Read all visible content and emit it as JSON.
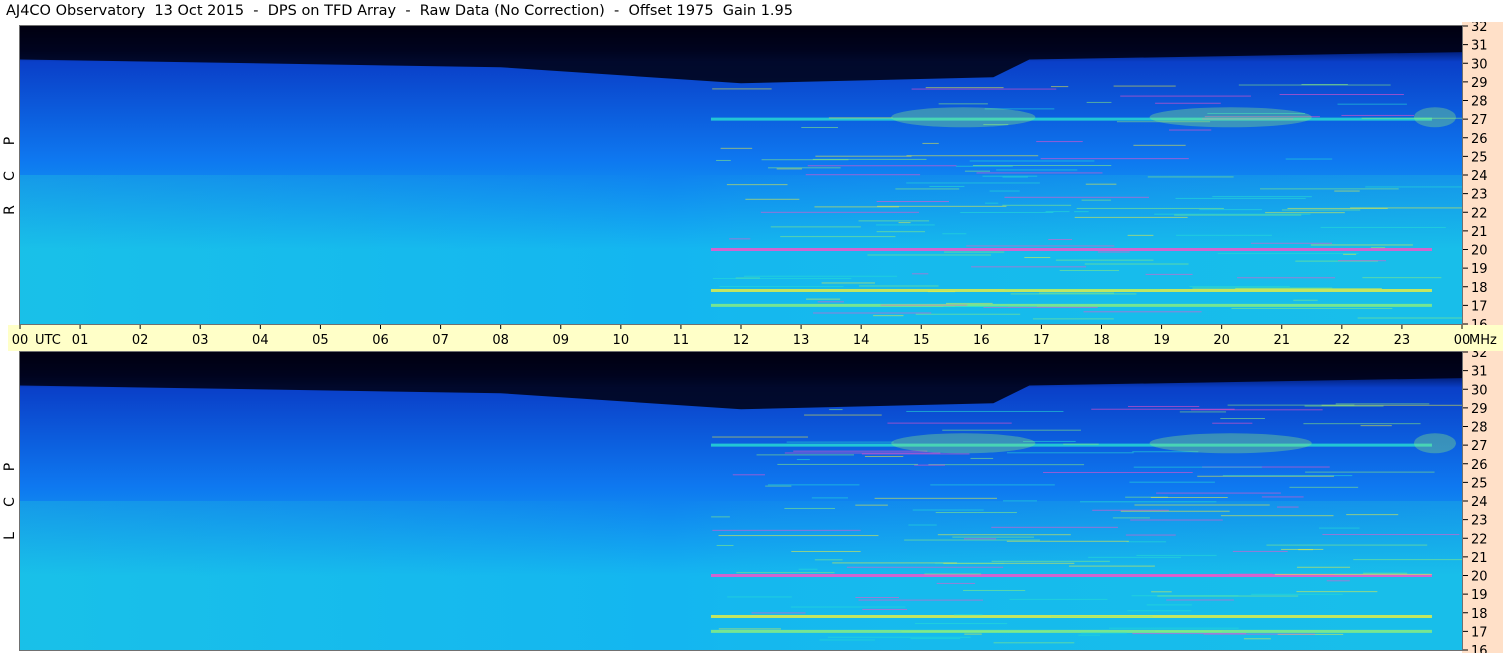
{
  "title": "AJ4CO Observatory  13 Oct 2015  -  DPS on TFD Array  -  Raw Data (No Correction)  -  Offset 1975  Gain 1.95",
  "colors": {
    "background": "#ffffff",
    "freq_axis_bg": "#ffe0c8",
    "time_axis_bg": "#ffffc8",
    "colormap": [
      "#000010",
      "#001a6e",
      "#0a3fc8",
      "#0e78f0",
      "#14b6f0",
      "#28e0d2",
      "#8ef07a",
      "#f0f03c",
      "#ff50c8"
    ]
  },
  "panels": [
    {
      "name": "R C P",
      "letters": [
        "P",
        "C",
        "R"
      ]
    },
    {
      "name": "L C P",
      "letters": [
        "P",
        "C",
        "L"
      ]
    }
  ],
  "chart_data": {
    "type": "heatmap",
    "title": "AJ4CO Observatory  13 Oct 2015  -  DPS on TFD Array  -  Raw Data (No Correction)  -  Offset 1975  Gain 1.95",
    "x_axis": {
      "unit": "UTC",
      "ticks": [
        "00",
        "01",
        "02",
        "03",
        "04",
        "05",
        "06",
        "07",
        "08",
        "09",
        "10",
        "11",
        "12",
        "13",
        "14",
        "15",
        "16",
        "17",
        "18",
        "19",
        "20",
        "21",
        "22",
        "23",
        "00"
      ],
      "range_hours": [
        0,
        24
      ]
    },
    "y_axis": {
      "unit": "MHz",
      "range": [
        16,
        32
      ],
      "ticks": [
        16,
        17,
        18,
        19,
        20,
        21,
        22,
        23,
        24,
        25,
        26,
        27,
        28,
        29,
        30,
        31,
        32
      ]
    },
    "series": [
      {
        "name": "R C P"
      },
      {
        "name": "L C P"
      }
    ],
    "features": {
      "dark_region_above_mhz": 30,
      "active_hours": [
        11.5,
        23.5
      ],
      "bright_band_mhz": [
        17,
        17.8,
        20,
        27
      ],
      "active_patches_27mhz_hours": [
        [
          14.5,
          16.9
        ],
        [
          18.8,
          21.5
        ],
        [
          23.2,
          23.9
        ]
      ]
    }
  }
}
